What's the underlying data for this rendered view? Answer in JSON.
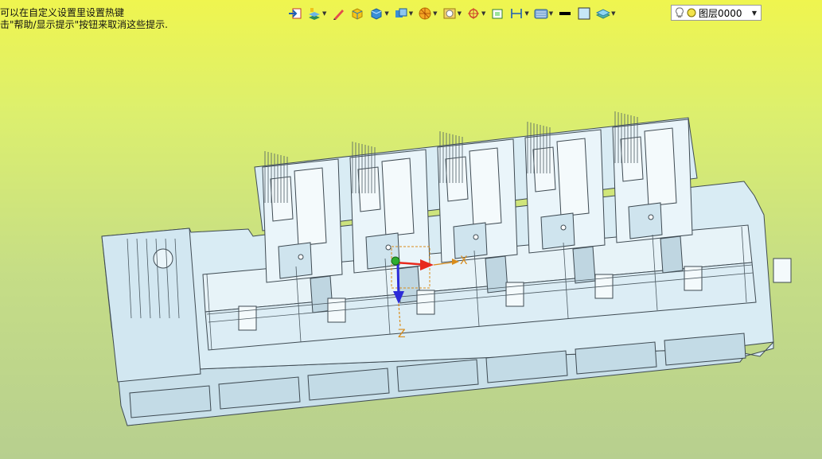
{
  "hints": {
    "line1": "可以在自定义设置里设置热键",
    "line2": "击\"帮助/显示提示\"按钮来取消这些提示."
  },
  "toolbar": {
    "items": [
      {
        "icon": "import-icon",
        "dropdown": false
      },
      {
        "icon": "layer-manager-icon",
        "dropdown": true
      },
      {
        "icon": "pencil-icon",
        "dropdown": false
      },
      {
        "icon": "solid-box-icon",
        "dropdown": false
      },
      {
        "icon": "cube-icon",
        "dropdown": true
      },
      {
        "icon": "view-cube-icon",
        "dropdown": true
      },
      {
        "icon": "render-sphere-icon",
        "dropdown": true
      },
      {
        "icon": "frame-icon",
        "dropdown": true
      },
      {
        "icon": "target-icon",
        "dropdown": true
      },
      {
        "icon": "snap-icon",
        "dropdown": false
      },
      {
        "icon": "dimension-icon",
        "dropdown": true
      },
      {
        "icon": "display-mode-icon",
        "dropdown": true
      },
      {
        "icon": "line-color-icon",
        "dropdown": false
      },
      {
        "icon": "fill-color-icon",
        "dropdown": false
      },
      {
        "icon": "layer-stack-icon",
        "dropdown": true
      }
    ],
    "layer_select": {
      "value": "图层0000"
    }
  },
  "triad": {
    "x_label": "X",
    "z_label": "Z"
  },
  "colors": {
    "model_fill": "#d9ecf4",
    "model_stroke": "#3e4a52",
    "axis_x": "#e8291c",
    "axis_z": "#2b2bd8",
    "axis_label": "#d98c1b"
  }
}
